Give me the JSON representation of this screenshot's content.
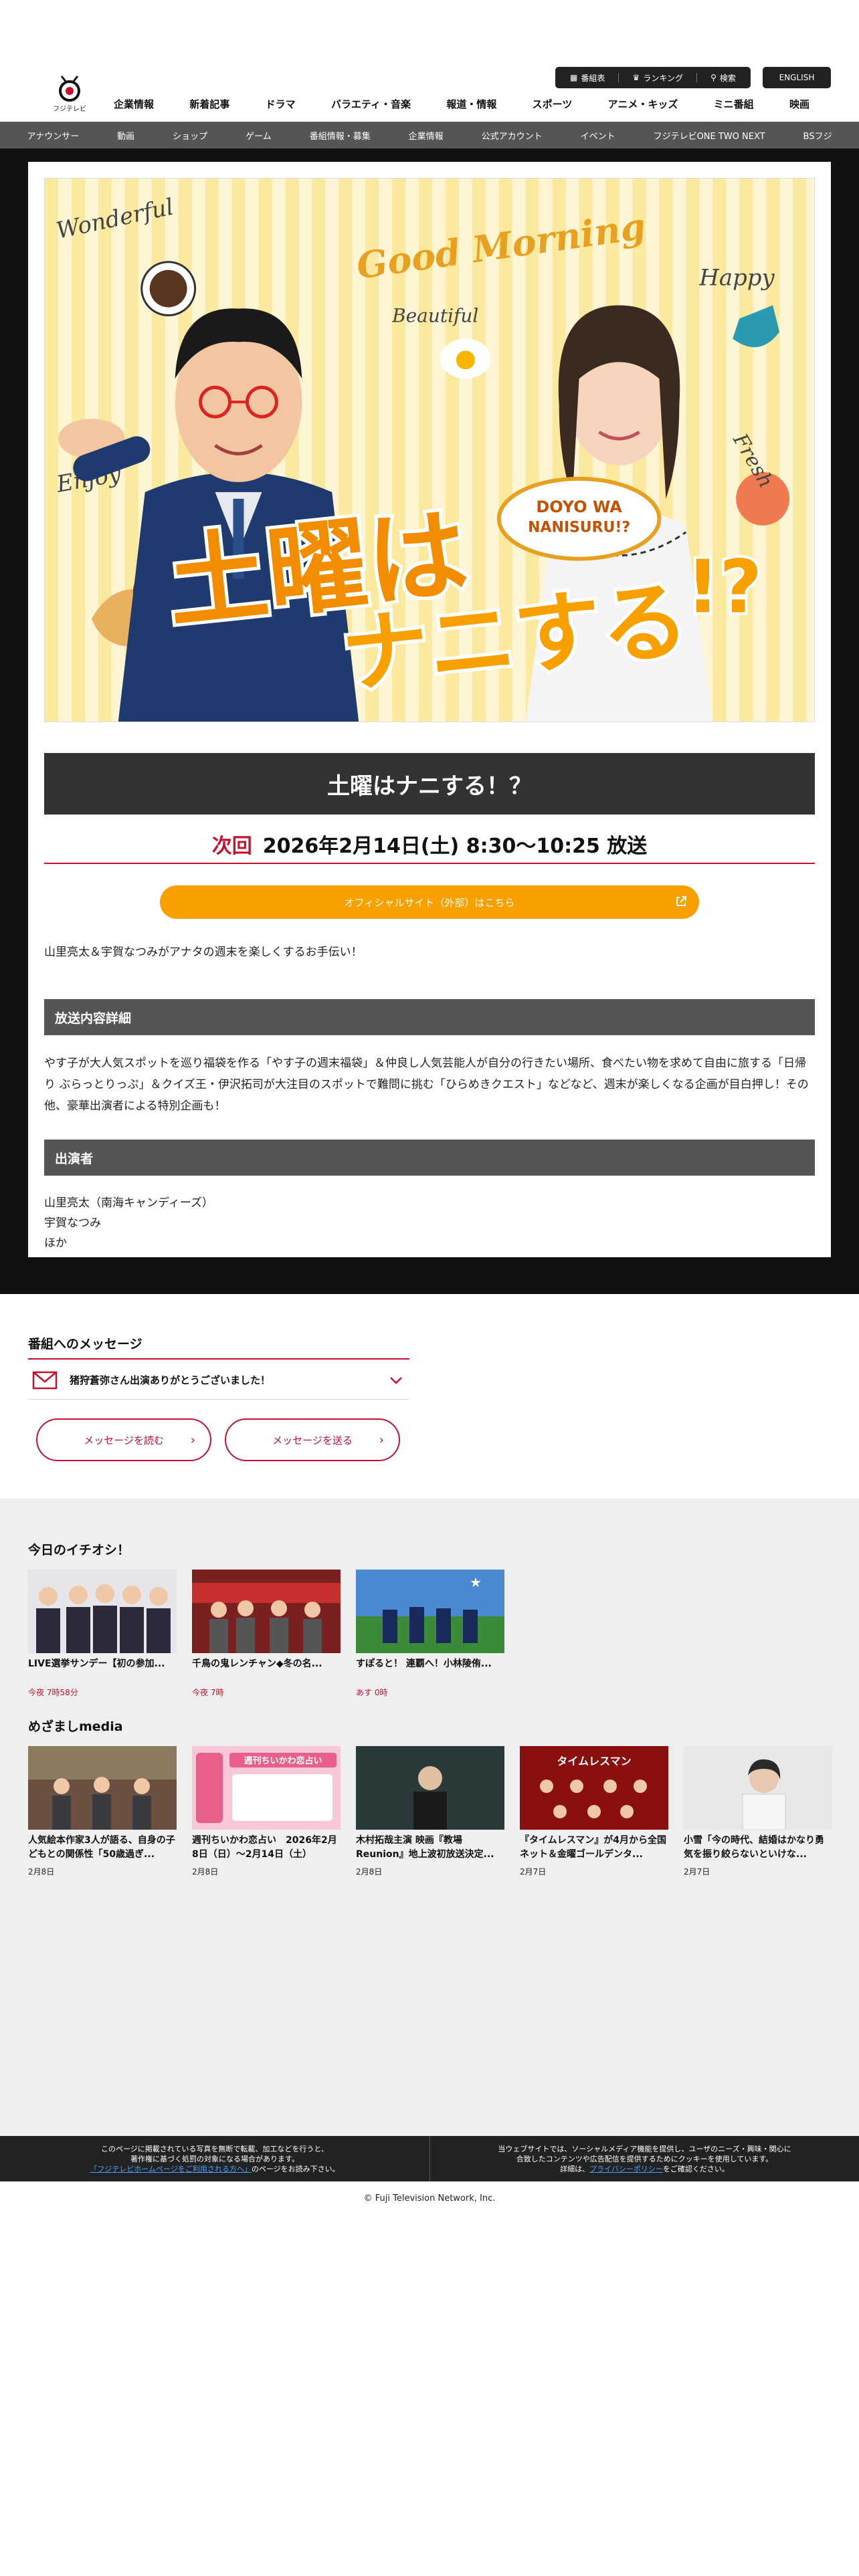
{
  "header": {
    "logo_text": "フジテレビ",
    "utility": {
      "program_list": "番組表",
      "ranking": "ランキング",
      "search": "検索"
    },
    "english": "ENGLISH",
    "nav": [
      "企業情報",
      "新着記事",
      "ドラマ",
      "バラエティ・音楽",
      "報道・情報",
      "スポーツ",
      "アニメ・キッズ",
      "ミニ番組",
      "映画"
    ],
    "subnav": [
      "アナウンサー",
      "動画",
      "ショップ",
      "ゲーム",
      "番組情報・募集",
      "企業情報",
      "公式アカウント",
      "イベント",
      "フジテレビONE TWO NEXT",
      "BSフジ"
    ]
  },
  "hero": {
    "title_top": "土曜は",
    "title_bottom": "ナニする",
    "title_mark": "!?",
    "badge_line1": "DOYO WA",
    "badge_line2": "NANISURU!?",
    "good_morning": "Good Morning",
    "words": [
      "Wonderful",
      "Beautiful",
      "Happy",
      "Enjoy",
      "Fresh"
    ]
  },
  "program": {
    "title": "土曜はナニする！？",
    "next_label": "次回",
    "next_datetime": "2026年2月14日(土) 8:30〜10:25 放送",
    "official_link": "オフィシャルサイト（外部）はこちら",
    "intro": "山里亮太＆宇賀なつみがアナタの週末を楽しくするお手伝い！",
    "details_heading": "放送内容詳細",
    "details_text": "やす子が大人気スポットを巡り福袋を作る「やす子の週末福袋」＆仲良し人気芸能人が自分の行きたい場所、食べたい物を求めて自由に旅する「日帰り ぶらっとりっぷ」＆クイズ王・伊沢拓司が大注目のスポットで難問に挑む「ひらめきクエスト」などなど、週末が楽しくなる企画が目白押し！その他、豪華出演者による特別企画も！",
    "cast_heading": "出演者",
    "cast": [
      "山里亮太（南海キャンディーズ）",
      "宇賀なつみ",
      "ほか"
    ]
  },
  "messages": {
    "heading": "番組へのメッセージ",
    "latest": "猪狩蒼弥さん出演ありがとうございました！",
    "read_button": "メッセージを読む",
    "send_button": "メッセージを送る"
  },
  "pickup": {
    "heading": "今日のイチオシ！",
    "items": [
      {
        "title": "LIVE選挙サンデー【初の参加...",
        "meta": "今夜 7時58分"
      },
      {
        "title": "千鳥の鬼レンチャン◆冬の名...",
        "meta": "今夜 7時"
      },
      {
        "title": "すぽると！ 連覇へ！小林陵侑...",
        "meta": "あす 0時"
      }
    ]
  },
  "mezamashi": {
    "heading": "めざましmedia",
    "items": [
      {
        "title": "人気絵本作家3人が語る、自身の子どもとの関係性「50歳過ぎ...",
        "date": "2月8日"
      },
      {
        "title": "週刊ちいかわ恋占い　2026年2月8日（日）〜2月14日（土）",
        "date": "2月8日"
      },
      {
        "title": "木村拓哉主演 映画『教場 Reunion』地上波初放送決定...",
        "date": "2月8日"
      },
      {
        "title": "『タイムレスマン』が4月から全国ネット＆金曜ゴールデンタ...",
        "date": "2月7日"
      },
      {
        "title": "小雪「今の時代、結婚はかなり勇気を振り絞らないといけな...",
        "date": "2月7日"
      }
    ],
    "thumb_text_uranai": "週刊ちいかわ恋占い",
    "thumb_text_timeless": "タイムレスマン"
  },
  "footer": {
    "left_line1": "このページに掲載されている写真を無断で転載、加工などを行うと、",
    "left_line2": "著作権に基づく処罰の対象になる場合があります。",
    "left_link": "「フジテレビホームページをご利用される方へ」",
    "left_suffix": "のページをお読み下さい。",
    "right_line1": "当ウェブサイトでは、ソーシャルメディア機能を提供し、ユーザのニーズ・興味・関心に",
    "right_line2": "合致したコンテンツや広告配信を提供するためにクッキーを使用しています。",
    "right_prefix": "詳細は、",
    "right_link": "プライバシーポリシー",
    "right_suffix": "をご確認ください。",
    "copyright": "© Fuji Television Network, Inc."
  },
  "colors": {
    "accent_red": "#c8102e",
    "accent_orange": "#f7a000",
    "dark": "#111111",
    "bar_grey": "#555555"
  }
}
